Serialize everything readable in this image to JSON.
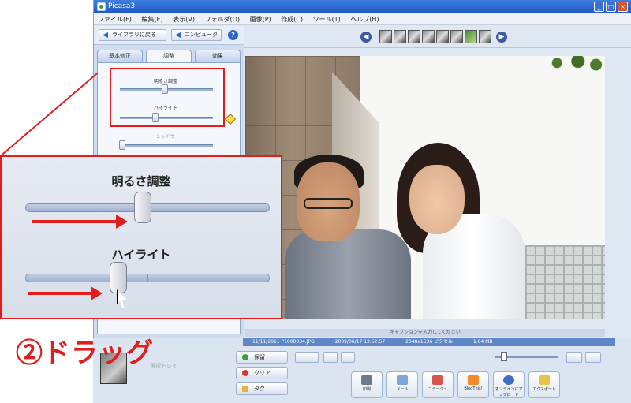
{
  "window": {
    "title": "Picasa3",
    "minimize": "_",
    "maximize": "□",
    "close": "×"
  },
  "menu": [
    "ファイル(F)",
    "編集(E)",
    "表示(V)",
    "フォルダ(O)",
    "画像(P)",
    "作成(C)",
    "ツール(T)",
    "ヘルプ(H)"
  ],
  "nav": {
    "back_label": "ライブラリに戻る",
    "prev_label": "コンピュータ",
    "help": "?"
  },
  "tabs": [
    "基本修正",
    "調整",
    "効果"
  ],
  "small_panel": {
    "brightness_label": "明るさ調整",
    "highlight_label": "ハイライト",
    "third_label": "シャドウ"
  },
  "filmstrip": {
    "prev": "◀",
    "next": "▶"
  },
  "photo_caption": "キャプションを入力してください",
  "info_strip": [
    "11/11/2011 P1000034.JPG",
    "2009/06/17 13:52:57",
    "2048x1536 ピクセル",
    "1.04 MB"
  ],
  "tray": {
    "label": "選択トレイ"
  },
  "side_buttons": [
    "保留",
    "クリア",
    "タグ"
  ],
  "action_buttons": [
    "印刷",
    "メール",
    "コラージュ",
    "BlogThis!",
    "オンラインにアップロード",
    "エクスポート"
  ],
  "zoom_panel": {
    "brightness_label": "明るさ調整",
    "highlight_label": "ハイライト"
  },
  "brightness_value": 0.48,
  "highlight_value": 0.38,
  "instruction": "②ドラッグ",
  "colors": {
    "accent": "#e01e1e",
    "title_bar": "#2a63d0"
  }
}
